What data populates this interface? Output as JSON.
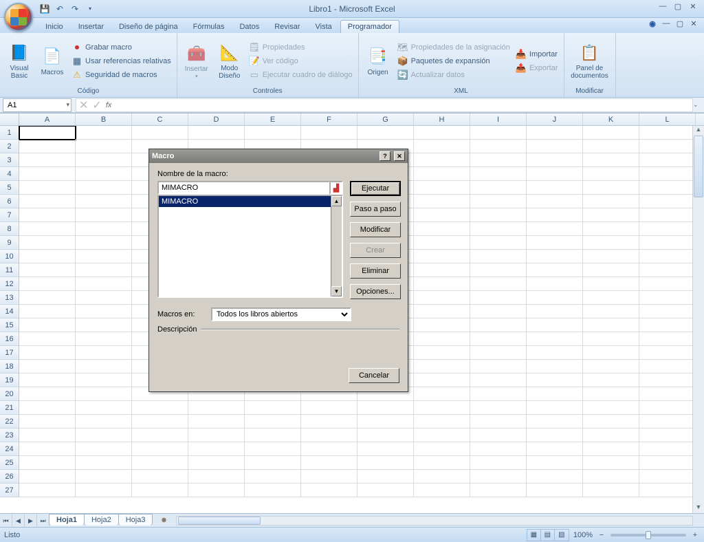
{
  "title": "Libro1 - Microsoft Excel",
  "tabs": [
    "Inicio",
    "Insertar",
    "Diseño de página",
    "Fórmulas",
    "Datos",
    "Revisar",
    "Vista",
    "Programador"
  ],
  "active_tab": 7,
  "ribbon": {
    "codigo": {
      "label": "Código",
      "visual_basic": "Visual Basic",
      "macros": "Macros",
      "grabar": "Grabar macro",
      "refs": "Usar referencias relativas",
      "seguridad": "Seguridad de macros"
    },
    "controles": {
      "label": "Controles",
      "insertar": "Insertar",
      "modo": "Modo Diseño",
      "propiedades": "Propiedades",
      "ver_codigo": "Ver código",
      "ejecutar_dlg": "Ejecutar cuadro de diálogo"
    },
    "xml": {
      "label": "XML",
      "origen": "Origen",
      "prop_asig": "Propiedades de la asignación",
      "paquetes": "Paquetes de expansión",
      "actualizar": "Actualizar datos",
      "importar": "Importar",
      "exportar": "Exportar"
    },
    "modificar": {
      "label": "Modificar",
      "panel": "Panel de documentos"
    }
  },
  "namebox": "A1",
  "columns": [
    "A",
    "B",
    "C",
    "D",
    "E",
    "F",
    "G",
    "H",
    "I",
    "J",
    "K",
    "L"
  ],
  "rows": 27,
  "sheets": [
    "Hoja1",
    "Hoja2",
    "Hoja3"
  ],
  "active_sheet": 0,
  "status": "Listo",
  "zoom": "100%",
  "dialog": {
    "title": "Macro",
    "name_label": "Nombre de la macro:",
    "macro_name": "MIMACRO",
    "list": [
      "MIMACRO"
    ],
    "buttons": {
      "ejecutar": "Ejecutar",
      "paso": "Paso a paso",
      "modificar": "Modificar",
      "crear": "Crear",
      "eliminar": "Eliminar",
      "opciones": "Opciones...",
      "cancelar": "Cancelar"
    },
    "macros_en_label": "Macros en:",
    "macros_en_value": "Todos los libros abiertos",
    "descripcion_label": "Descripción"
  }
}
